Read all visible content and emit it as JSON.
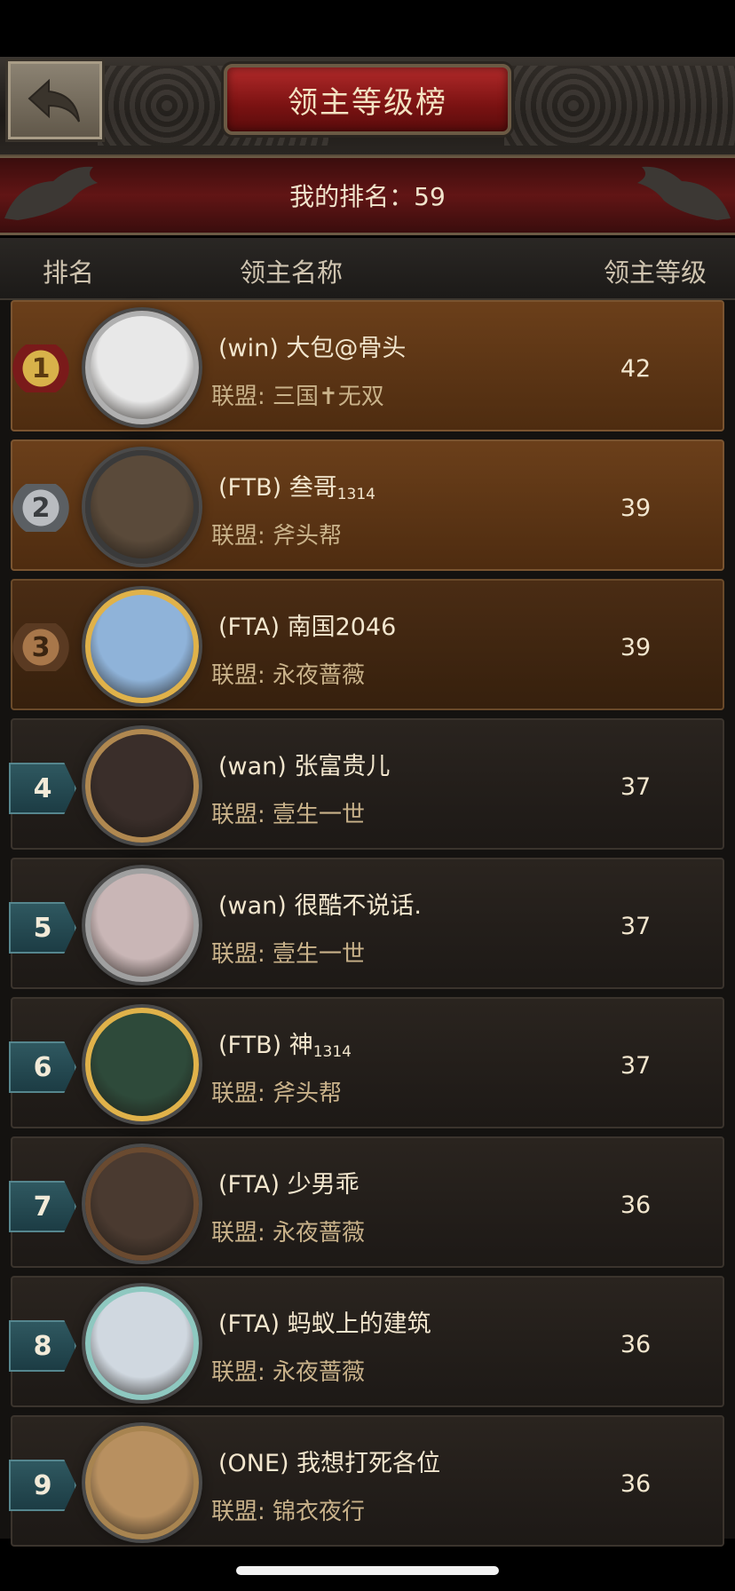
{
  "header": {
    "title": "领主等级榜",
    "my_rank_label": "我的排名：59"
  },
  "columns": {
    "rank": "排名",
    "name": "领主名称",
    "level": "领主等级"
  },
  "rows": [
    {
      "rank": "1",
      "name": "(win) 大包@骨头",
      "alliance": "联盟: 三国✝无双",
      "level": "42"
    },
    {
      "rank": "2",
      "name": "(FTB) 叁哥",
      "name_sub": "1314",
      "alliance": "联盟: 斧头帮",
      "level": "39"
    },
    {
      "rank": "3",
      "name": "(FTA) 南国2046",
      "alliance": "联盟: 永夜蔷薇",
      "level": "39"
    },
    {
      "rank": "4",
      "name": "(wan) 张富贵儿",
      "alliance": "联盟: 壹生一世",
      "level": "37"
    },
    {
      "rank": "5",
      "name": "(wan) 很酷不说话.",
      "alliance": "联盟: 壹生一世",
      "level": "37"
    },
    {
      "rank": "6",
      "name": "(FTB) 神",
      "name_sub": "1314",
      "alliance": "联盟: 斧头帮",
      "level": "37"
    },
    {
      "rank": "7",
      "name": "(FTA) 少男乖",
      "alliance": "联盟: 永夜蔷薇",
      "level": "36"
    },
    {
      "rank": "8",
      "name": "(FTA) 蚂蚁上的建筑",
      "alliance": "联盟: 永夜蔷薇",
      "level": "36"
    },
    {
      "rank": "9",
      "name": "(ONE) 我想打死各位",
      "alliance": "联盟: 锦衣夜行",
      "level": "36"
    }
  ],
  "icons": {
    "back": "back-arrow-icon",
    "medal": "rank-medal-icon",
    "dragon": "dragon-ornament-icon"
  },
  "colors": {
    "title_red": "#b22a2a",
    "gold_row": "#6b3f1a",
    "teal_badge": "#2f5860",
    "text_gold": "#c9b28a"
  }
}
